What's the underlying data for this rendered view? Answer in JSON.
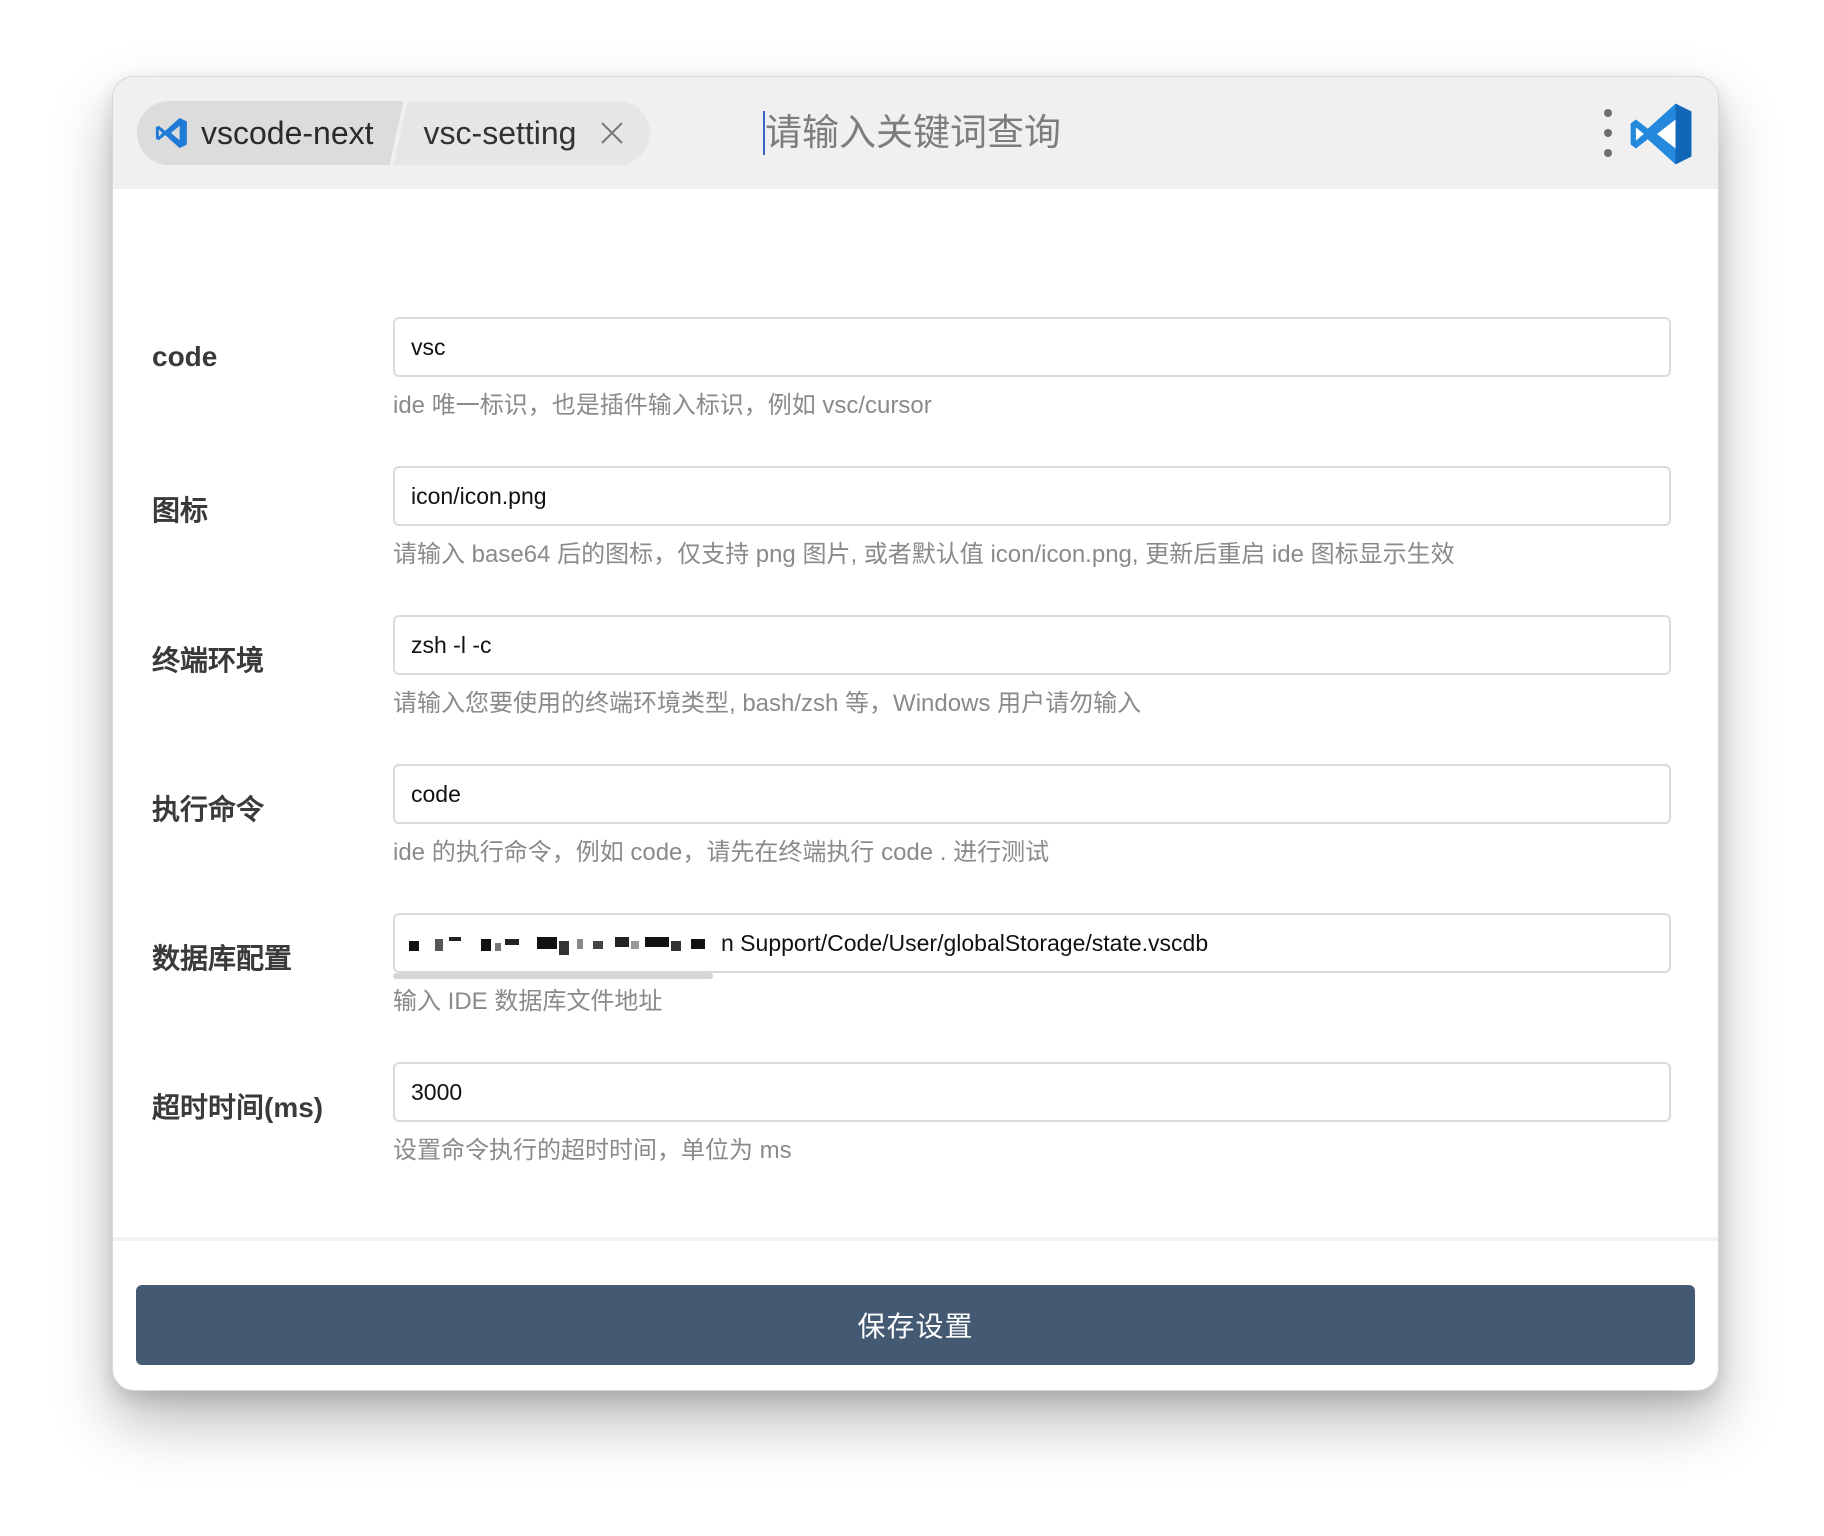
{
  "tabs": {
    "primary": {
      "label": "vscode-next",
      "icon": "vscode-icon"
    },
    "secondary": {
      "label": "vsc-setting",
      "icon": "close-icon"
    }
  },
  "search": {
    "placeholder": "请输入关键词查询",
    "value": ""
  },
  "header": {
    "menu_icon": "more-vertical-icon",
    "logo_icon": "vscode-logo-icon"
  },
  "form": {
    "code": {
      "label": "code",
      "value": "vsc",
      "hint": "ide 唯一标识，也是插件输入标识，例如 vsc/cursor"
    },
    "icon": {
      "label": "图标",
      "value": "icon/icon.png",
      "hint": "请输入 base64 后的图标，仅支持 png 图片, 或者默认值 icon/icon.png, 更新后重启 ide 图标显示生效"
    },
    "terminal": {
      "label": "终端环境",
      "value": "zsh -l -c",
      "hint": "请输入您要使用的终端环境类型, bash/zsh 等，Windows 用户请勿输入"
    },
    "command": {
      "label": "执行命令",
      "value": "code",
      "hint": "ide 的执行命令，例如 code，请先在终端执行 code . 进行测试"
    },
    "database": {
      "label": "数据库配置",
      "value_visible": "n Support/Code/User/globalStorage/state.vscdb",
      "hint": "输入 IDE 数据库文件地址"
    },
    "timeout": {
      "label": "超时时间(ms)",
      "value": "3000",
      "hint": "设置命令执行的超时时间，单位为 ms"
    }
  },
  "footer": {
    "save_label": "保存设置"
  },
  "colors": {
    "accent": "#445a72",
    "vscode_blue": "#1f7bd6",
    "caret": "#3b63c9"
  }
}
